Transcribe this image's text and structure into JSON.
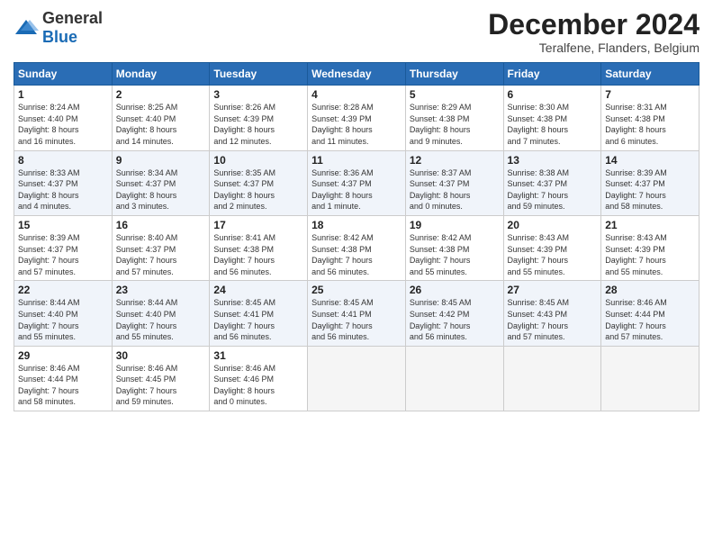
{
  "header": {
    "logo_general": "General",
    "logo_blue": "Blue",
    "month_title": "December 2024",
    "subtitle": "Teralfene, Flanders, Belgium"
  },
  "weekdays": [
    "Sunday",
    "Monday",
    "Tuesday",
    "Wednesday",
    "Thursday",
    "Friday",
    "Saturday"
  ],
  "weeks": [
    [
      {
        "day": "1",
        "info": "Sunrise: 8:24 AM\nSunset: 4:40 PM\nDaylight: 8 hours\nand 16 minutes."
      },
      {
        "day": "2",
        "info": "Sunrise: 8:25 AM\nSunset: 4:40 PM\nDaylight: 8 hours\nand 14 minutes."
      },
      {
        "day": "3",
        "info": "Sunrise: 8:26 AM\nSunset: 4:39 PM\nDaylight: 8 hours\nand 12 minutes."
      },
      {
        "day": "4",
        "info": "Sunrise: 8:28 AM\nSunset: 4:39 PM\nDaylight: 8 hours\nand 11 minutes."
      },
      {
        "day": "5",
        "info": "Sunrise: 8:29 AM\nSunset: 4:38 PM\nDaylight: 8 hours\nand 9 minutes."
      },
      {
        "day": "6",
        "info": "Sunrise: 8:30 AM\nSunset: 4:38 PM\nDaylight: 8 hours\nand 7 minutes."
      },
      {
        "day": "7",
        "info": "Sunrise: 8:31 AM\nSunset: 4:38 PM\nDaylight: 8 hours\nand 6 minutes."
      }
    ],
    [
      {
        "day": "8",
        "info": "Sunrise: 8:33 AM\nSunset: 4:37 PM\nDaylight: 8 hours\nand 4 minutes."
      },
      {
        "day": "9",
        "info": "Sunrise: 8:34 AM\nSunset: 4:37 PM\nDaylight: 8 hours\nand 3 minutes."
      },
      {
        "day": "10",
        "info": "Sunrise: 8:35 AM\nSunset: 4:37 PM\nDaylight: 8 hours\nand 2 minutes."
      },
      {
        "day": "11",
        "info": "Sunrise: 8:36 AM\nSunset: 4:37 PM\nDaylight: 8 hours\nand 1 minute."
      },
      {
        "day": "12",
        "info": "Sunrise: 8:37 AM\nSunset: 4:37 PM\nDaylight: 8 hours\nand 0 minutes."
      },
      {
        "day": "13",
        "info": "Sunrise: 8:38 AM\nSunset: 4:37 PM\nDaylight: 7 hours\nand 59 minutes."
      },
      {
        "day": "14",
        "info": "Sunrise: 8:39 AM\nSunset: 4:37 PM\nDaylight: 7 hours\nand 58 minutes."
      }
    ],
    [
      {
        "day": "15",
        "info": "Sunrise: 8:39 AM\nSunset: 4:37 PM\nDaylight: 7 hours\nand 57 minutes."
      },
      {
        "day": "16",
        "info": "Sunrise: 8:40 AM\nSunset: 4:37 PM\nDaylight: 7 hours\nand 57 minutes."
      },
      {
        "day": "17",
        "info": "Sunrise: 8:41 AM\nSunset: 4:38 PM\nDaylight: 7 hours\nand 56 minutes."
      },
      {
        "day": "18",
        "info": "Sunrise: 8:42 AM\nSunset: 4:38 PM\nDaylight: 7 hours\nand 56 minutes."
      },
      {
        "day": "19",
        "info": "Sunrise: 8:42 AM\nSunset: 4:38 PM\nDaylight: 7 hours\nand 55 minutes."
      },
      {
        "day": "20",
        "info": "Sunrise: 8:43 AM\nSunset: 4:39 PM\nDaylight: 7 hours\nand 55 minutes."
      },
      {
        "day": "21",
        "info": "Sunrise: 8:43 AM\nSunset: 4:39 PM\nDaylight: 7 hours\nand 55 minutes."
      }
    ],
    [
      {
        "day": "22",
        "info": "Sunrise: 8:44 AM\nSunset: 4:40 PM\nDaylight: 7 hours\nand 55 minutes."
      },
      {
        "day": "23",
        "info": "Sunrise: 8:44 AM\nSunset: 4:40 PM\nDaylight: 7 hours\nand 55 minutes."
      },
      {
        "day": "24",
        "info": "Sunrise: 8:45 AM\nSunset: 4:41 PM\nDaylight: 7 hours\nand 56 minutes."
      },
      {
        "day": "25",
        "info": "Sunrise: 8:45 AM\nSunset: 4:41 PM\nDaylight: 7 hours\nand 56 minutes."
      },
      {
        "day": "26",
        "info": "Sunrise: 8:45 AM\nSunset: 4:42 PM\nDaylight: 7 hours\nand 56 minutes."
      },
      {
        "day": "27",
        "info": "Sunrise: 8:45 AM\nSunset: 4:43 PM\nDaylight: 7 hours\nand 57 minutes."
      },
      {
        "day": "28",
        "info": "Sunrise: 8:46 AM\nSunset: 4:44 PM\nDaylight: 7 hours\nand 57 minutes."
      }
    ],
    [
      {
        "day": "29",
        "info": "Sunrise: 8:46 AM\nSunset: 4:44 PM\nDaylight: 7 hours\nand 58 minutes."
      },
      {
        "day": "30",
        "info": "Sunrise: 8:46 AM\nSunset: 4:45 PM\nDaylight: 7 hours\nand 59 minutes."
      },
      {
        "day": "31",
        "info": "Sunrise: 8:46 AM\nSunset: 4:46 PM\nDaylight: 8 hours\nand 0 minutes."
      },
      null,
      null,
      null,
      null
    ]
  ]
}
